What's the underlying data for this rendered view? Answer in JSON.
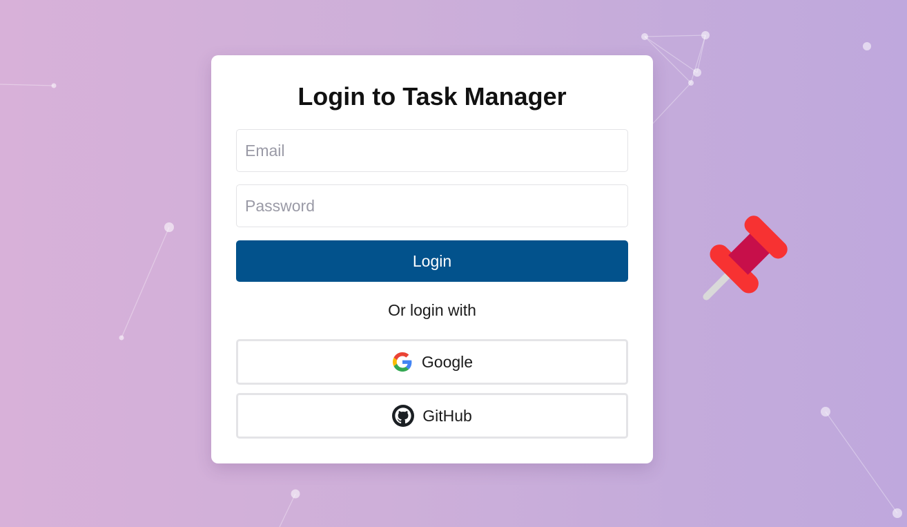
{
  "page": {
    "title": "Login to Task Manager"
  },
  "form": {
    "email": {
      "placeholder": "Email",
      "value": ""
    },
    "password": {
      "placeholder": "Password",
      "value": ""
    },
    "login_label": "Login"
  },
  "social": {
    "divider_text": "Or login with",
    "google_label": "Google",
    "github_label": "GitHub"
  },
  "icons": {
    "google": "google-icon",
    "github": "github-icon",
    "decoration": "pushpin-icon"
  },
  "colors": {
    "primary_button": "#02528c",
    "background_start": "#d8b1d9",
    "background_end": "#bfa8dd",
    "pin_head": "#f73232",
    "pin_body": "#c70f4a"
  }
}
